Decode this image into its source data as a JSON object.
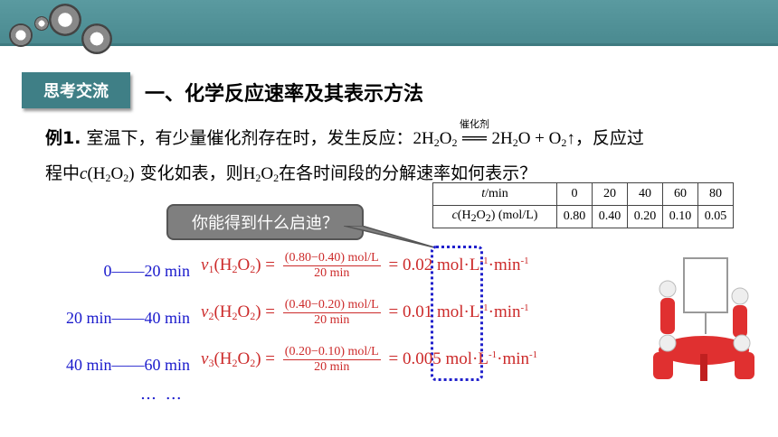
{
  "tag": "思考交流",
  "title": "一、化学反应速率及其表示方法",
  "example": {
    "label": "例1.",
    "line1_a": " 室温下，有少量催化剂存在时，发生反应：",
    "catalyst": "催化剂",
    "line1_b": "，反应过",
    "line2_a": "程中",
    "line2_b": " 变化如表，则",
    "line2_c": "在各时间段的分解速率如何表示？"
  },
  "table": {
    "row1": [
      "t/min",
      "0",
      "20",
      "40",
      "60",
      "80"
    ],
    "row2": [
      "c(H2O2) (mol/L)",
      "0.80",
      "0.40",
      "0.20",
      "0.10",
      "0.05"
    ]
  },
  "bubble": "你能得到什么启迪？",
  "rows": [
    {
      "time": "0——20 min",
      "num": "(0.80−0.40) mol/L",
      "den": "20 min",
      "result": "= 0.02 mol·L",
      "sub": "1"
    },
    {
      "time": "20 min——40 min",
      "num": "(0.40−0.20) mol/L",
      "den": "20 min",
      "result": "= 0.01 mol·L",
      "sub": "2"
    },
    {
      "time": "40 min——60 min",
      "num": "(0.20−0.10) mol/L",
      "den": "20 min",
      "result": "= 0.005 mol·L",
      "sub": "3"
    }
  ],
  "dots": "… …",
  "colors": {
    "header": "#4a8a90",
    "tag": "#3f7f86",
    "time": "#1a1acc",
    "equation": "#cc2a2a",
    "highlight_box": "#2020cc"
  }
}
